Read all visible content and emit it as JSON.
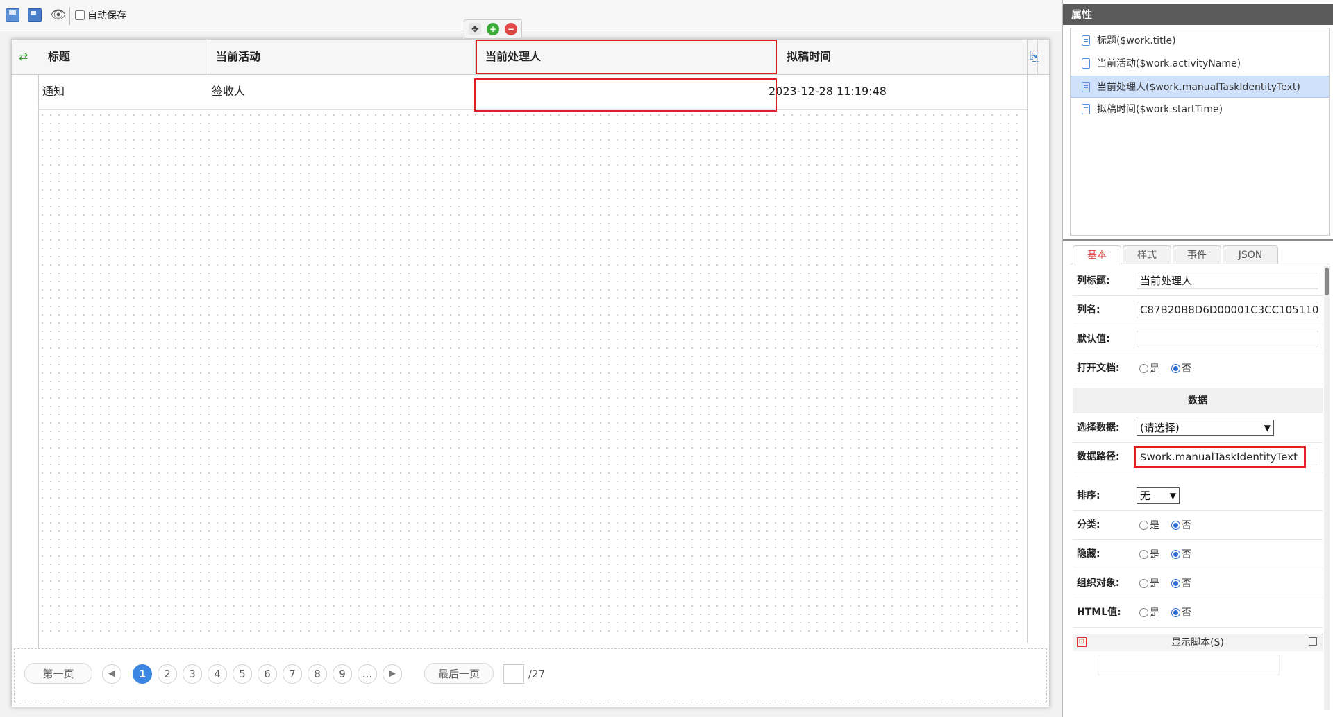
{
  "toolbar": {
    "autosave_label": "自动保存"
  },
  "view": {
    "columns": [
      {
        "label": "标题"
      },
      {
        "label": "当前活动"
      },
      {
        "label": "当前处理人"
      },
      {
        "label": "拟稿时间"
      }
    ],
    "rows": [
      {
        "cells": [
          "通知",
          "签收人",
          "",
          "2023-12-28 11:19:48"
        ]
      }
    ]
  },
  "pager": {
    "first_label": "第一页",
    "last_label": "最后一页",
    "pages": [
      "1",
      "2",
      "3",
      "4",
      "5",
      "6",
      "7",
      "8",
      "9",
      "..."
    ],
    "active_page": "1",
    "total": "/27"
  },
  "panel": {
    "title": "属性",
    "fields": [
      {
        "label": "标题($work.title)"
      },
      {
        "label": "当前活动($work.activityName)"
      },
      {
        "label": "当前处理人($work.manualTaskIdentityText)"
      },
      {
        "label": "拟稿时间($work.startTime)"
      }
    ],
    "tabs": [
      "基本",
      "样式",
      "事件",
      "JSON"
    ],
    "props": {
      "col_title_label": "列标题:",
      "col_title_value": "当前处理人",
      "col_name_label": "列名:",
      "col_name_value": "C87B20B8D6D00001C3CC105110",
      "default_label": "默认值:",
      "default_value": "",
      "open_doc_label": "打开文档:",
      "yes": "是",
      "no": "否",
      "data_section": "数据",
      "select_data_label": "选择数据:",
      "select_data_value": "(请选择)",
      "data_path_label": "数据路径:",
      "data_path_value": "$work.manualTaskIdentityText",
      "sort_label": "排序:",
      "sort_value": "无",
      "category_label": "分类:",
      "hidden_label": "隐藏:",
      "org_label": "组织对象:",
      "html_label": "HTML值:",
      "script_label": "显示脚本(S)"
    }
  }
}
